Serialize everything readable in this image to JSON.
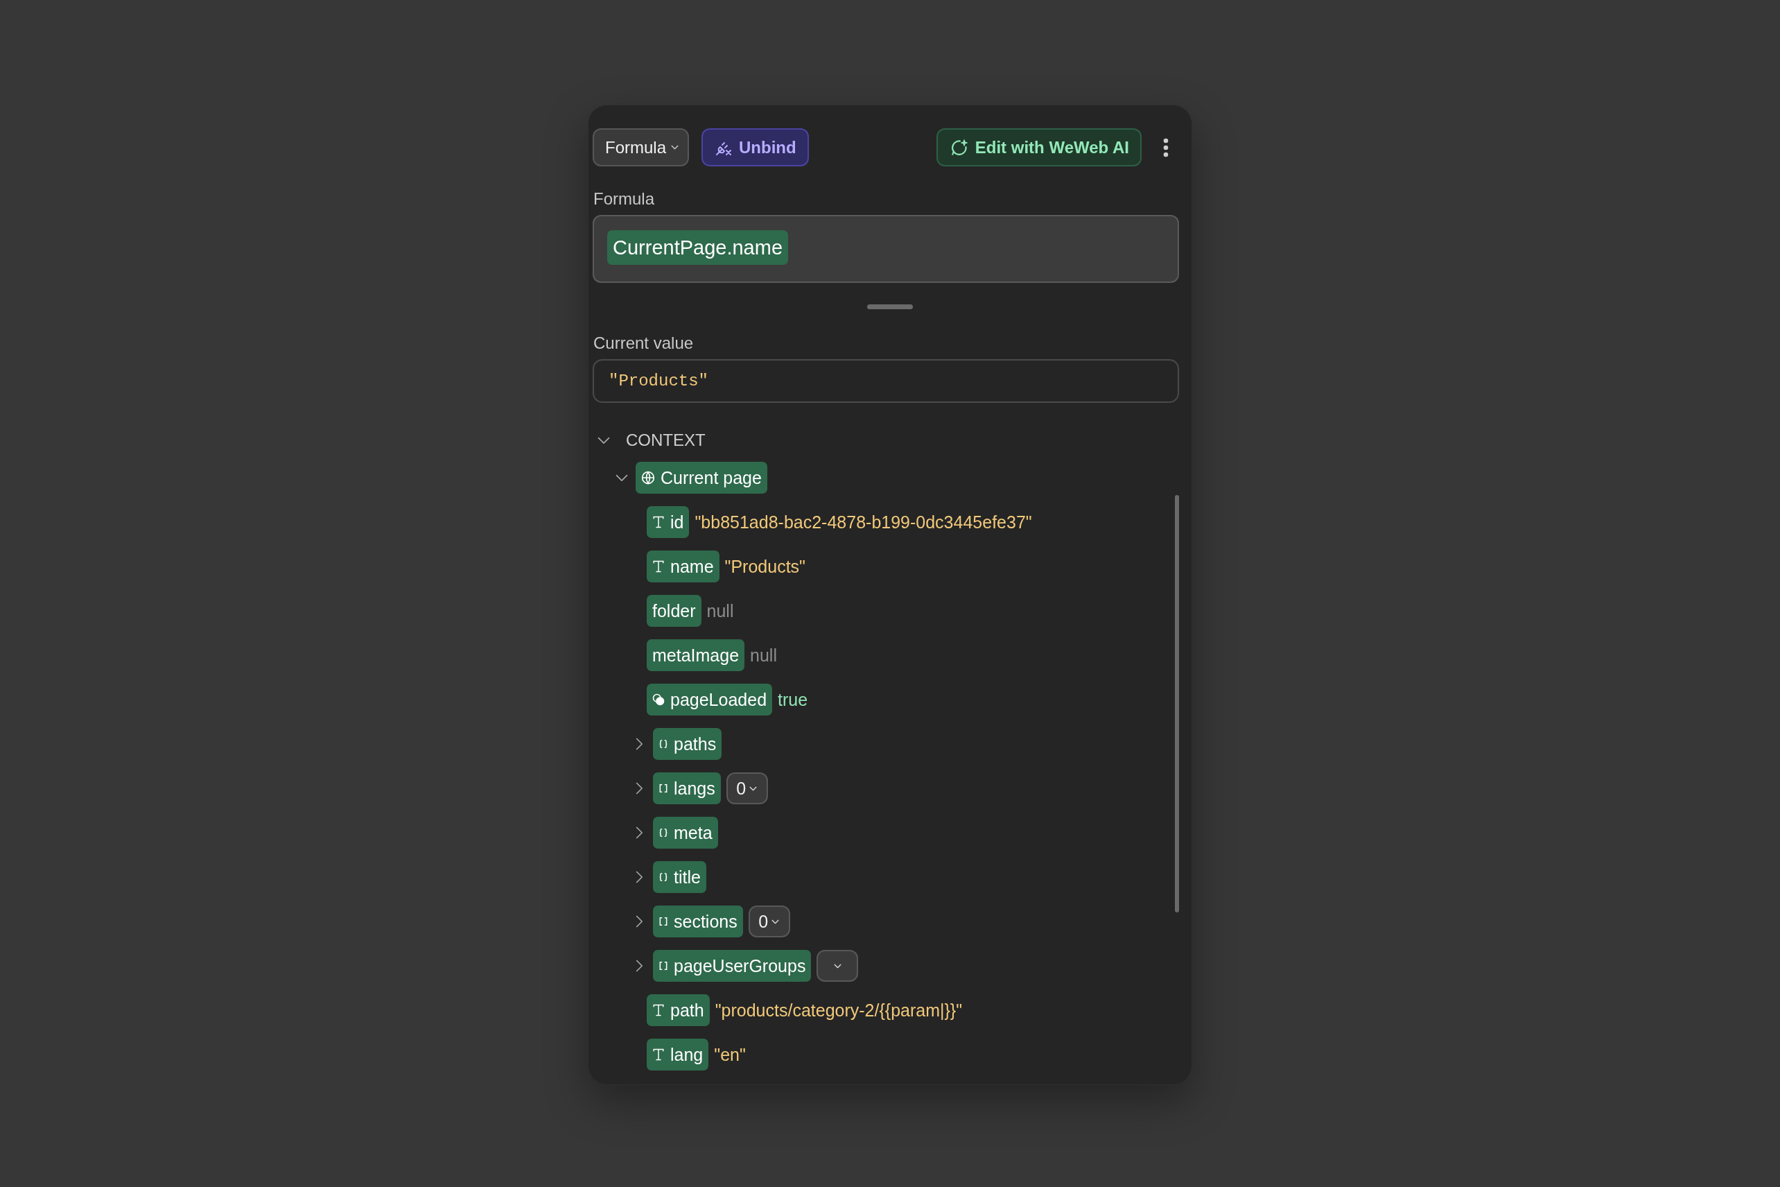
{
  "toolbar": {
    "mode_select": {
      "label": "Formula"
    },
    "unbind_button": {
      "label": "Unbind"
    },
    "ai_button": {
      "label": "Edit with WeWeb AI"
    }
  },
  "formula": {
    "label": "Formula",
    "tokens": [
      "CurrentPage.name"
    ]
  },
  "current_value": {
    "label": "Current value",
    "value": "\"Products\""
  },
  "context": {
    "label": "CONTEXT",
    "expanded": true,
    "children": [
      {
        "key": "Current page",
        "kind": "page",
        "expanded": true,
        "children": [
          {
            "key": "id",
            "kind": "text",
            "value": "\"bb851ad8-bac2-4878-b199-0dc3445efe37\"",
            "color": "#f2c97a"
          },
          {
            "key": "name",
            "kind": "text",
            "value": "\"Products\"",
            "color": "#f2c97a"
          },
          {
            "key": "folder",
            "kind": "unknown",
            "value": "null",
            "color": "#8d8d8d"
          },
          {
            "key": "metaImage",
            "kind": "unknown",
            "value": "null",
            "color": "#8d8d8d"
          },
          {
            "key": "pageLoaded",
            "kind": "boolean",
            "value": "true",
            "color": "#8fe3b4"
          },
          {
            "key": "paths",
            "kind": "object",
            "expanded": false
          },
          {
            "key": "langs",
            "kind": "array",
            "expanded": false,
            "index": "0"
          },
          {
            "key": "meta",
            "kind": "object",
            "expanded": false
          },
          {
            "key": "title",
            "kind": "object",
            "expanded": false
          },
          {
            "key": "sections",
            "kind": "array",
            "expanded": false,
            "index": "0"
          },
          {
            "key": "pageUserGroups",
            "kind": "array",
            "expanded": false
          },
          {
            "key": "path",
            "kind": "text",
            "value": "\"products/category-2/{{param|}}\"",
            "color": "#f2c97a"
          },
          {
            "key": "lang",
            "kind": "text",
            "value": "\"en\"",
            "color": "#f2c97a"
          }
        ]
      }
    ]
  }
}
